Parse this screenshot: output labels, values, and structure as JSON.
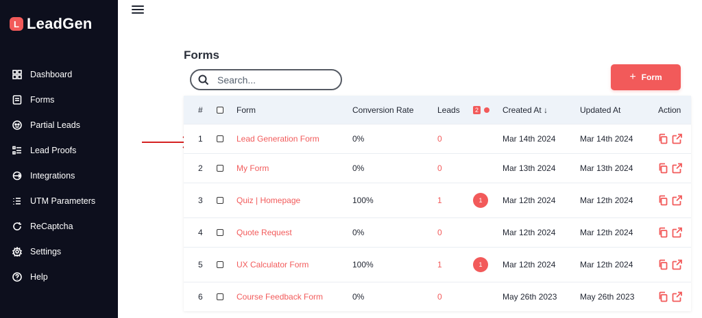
{
  "brand": {
    "logo_letter": "L",
    "name": "LeadGen"
  },
  "sidebar": {
    "items": [
      {
        "label": "Dashboard",
        "icon": "dashboard-icon"
      },
      {
        "label": "Forms",
        "icon": "forms-icon"
      },
      {
        "label": "Partial Leads",
        "icon": "partial-leads-icon"
      },
      {
        "label": "Lead Proofs",
        "icon": "lead-proofs-icon"
      },
      {
        "label": "Integrations",
        "icon": "integrations-icon"
      },
      {
        "label": "UTM Parameters",
        "icon": "utm-icon"
      },
      {
        "label": "ReCaptcha",
        "icon": "recaptcha-icon"
      },
      {
        "label": "Settings",
        "icon": "gear-icon"
      },
      {
        "label": "Help",
        "icon": "help-icon"
      }
    ]
  },
  "page": {
    "title": "Forms",
    "search_placeholder": "Search...",
    "add_button": {
      "plus": "+",
      "label": "Form"
    }
  },
  "table": {
    "headers": {
      "num": "#",
      "form": "Form",
      "conversion": "Conversion Rate",
      "leads": "Leads",
      "badge_count": "2",
      "created": "Created At",
      "sort_indicator": "↓",
      "updated": "Updated At",
      "action": "Action"
    },
    "rows": [
      {
        "num": "1",
        "form": "Lead Generation Form",
        "conversion": "0%",
        "leads": "0",
        "badge": "",
        "created": "Mar 14th 2024",
        "updated": "Mar 14th 2024"
      },
      {
        "num": "2",
        "form": "My Form",
        "conversion": "0%",
        "leads": "0",
        "badge": "",
        "created": "Mar 13th 2024",
        "updated": "Mar 13th 2024"
      },
      {
        "num": "3",
        "form": "Quiz | Homepage",
        "conversion": "100%",
        "leads": "1",
        "badge": "1",
        "created": "Mar 12th 2024",
        "updated": "Mar 12th 2024"
      },
      {
        "num": "4",
        "form": "Quote Request",
        "conversion": "0%",
        "leads": "0",
        "badge": "",
        "created": "Mar 12th 2024",
        "updated": "Mar 12th 2024"
      },
      {
        "num": "5",
        "form": "UX Calculator Form",
        "conversion": "100%",
        "leads": "1",
        "badge": "1",
        "created": "Mar 12th 2024",
        "updated": "Mar 12th 2024"
      },
      {
        "num": "6",
        "form": "Course Feedback Form",
        "conversion": "0%",
        "leads": "0",
        "badge": "",
        "created": "May 26th 2023",
        "updated": "May 26th 2023"
      }
    ]
  },
  "colors": {
    "accent": "#f25a5a",
    "sidebar_bg": "#0d0f1d",
    "header_bg": "#eef3f9",
    "annotation_arrow": "#d42020"
  }
}
